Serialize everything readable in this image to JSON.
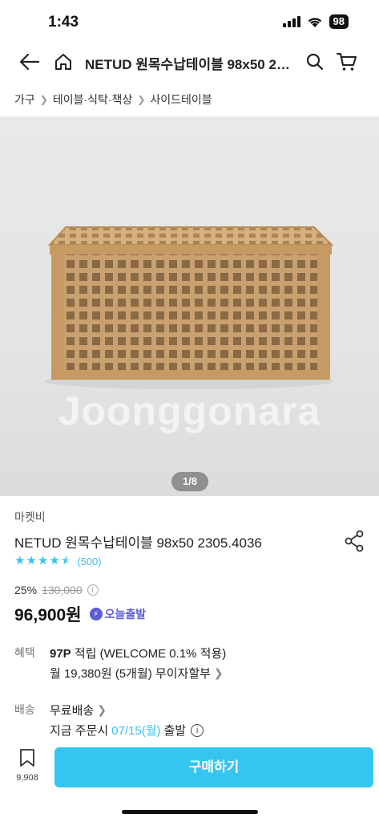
{
  "status_bar": {
    "time": "1:43",
    "battery": "98"
  },
  "nav": {
    "title": "NETUD 원목수납테이블 98x50 2305.4036"
  },
  "breadcrumb": [
    "가구",
    "테이블·식탁·책상",
    "사이드테이블"
  ],
  "image": {
    "watermark": "Joonggonara",
    "page_indicator": "1/8"
  },
  "product": {
    "seller": "마켓비",
    "title": "NETUD 원목수납테이블 98x50 2305.4036",
    "rating_stars": 4.5,
    "review_count": "(500)",
    "discount": "25%",
    "original_price": "130,000",
    "price": "96,900원",
    "badge": "오늘출발"
  },
  "benefit": {
    "label": "혜택",
    "points": "97P",
    "points_text": " 적립 (WELCOME 0.1% 적용)",
    "installment": "월 19,380원 (5개월) 무이자할부"
  },
  "shipping": {
    "label": "배송",
    "type": "무료배송",
    "order_prefix": "지금 주문시",
    "date": "07/15(월)",
    "order_suffix": "출발"
  },
  "bottom": {
    "bookmark_count": "9,908",
    "buy_label": "구매하기"
  },
  "colors": {
    "accent": "#35c5f0",
    "badge": "#5b5bd6"
  }
}
